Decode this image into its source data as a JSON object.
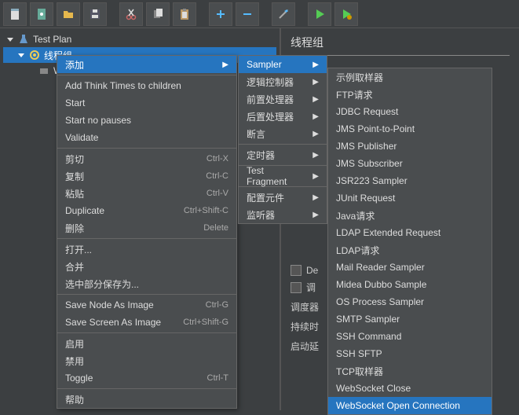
{
  "toolbar_icons": [
    "new",
    "open",
    "folder",
    "save",
    "",
    "cut",
    "copy",
    "paste",
    "",
    "plus",
    "minus",
    "",
    "wand",
    "",
    "run",
    "run-alt"
  ],
  "tree": {
    "root": "Test Plan",
    "thread_group": "线程组",
    "child": "We"
  },
  "right": {
    "title": "线程组",
    "default_cb": "De",
    "debug_cb": "调",
    "scheduler": "调度器",
    "duration": "持续时",
    "startup_delay": "启动延"
  },
  "context": {
    "add": "添加",
    "add_think": "Add Think Times to children",
    "start": "Start",
    "start_no_pauses": "Start no pauses",
    "validate": "Validate",
    "cut": "剪切",
    "copy": "复制",
    "paste": "粘贴",
    "duplicate": "Duplicate",
    "delete": "删除",
    "open": "打开...",
    "merge": "合并",
    "save_sel": "选中部分保存为...",
    "save_node": "Save Node As Image",
    "save_screen": "Save Screen As Image",
    "enable": "启用",
    "disable": "禁用",
    "toggle": "Toggle",
    "help": "帮助",
    "sc_cut": "Ctrl-X",
    "sc_copy": "Ctrl-C",
    "sc_paste": "Ctrl-V",
    "sc_dup": "Ctrl+Shift-C",
    "sc_del": "Delete",
    "sc_g": "Ctrl-G",
    "sc_sg": "Ctrl+Shift-G",
    "sc_t": "Ctrl-T"
  },
  "sub2": {
    "sampler": "Sampler",
    "logic": "逻辑控制器",
    "pre": "前置处理器",
    "post": "后置处理器",
    "assert": "断言",
    "timer": "定时器",
    "frag": "Test Fragment",
    "config": "配置元件",
    "listener": "监听器"
  },
  "sub3": [
    "示例取样器",
    "FTP请求",
    "JDBC Request",
    "JMS Point-to-Point",
    "JMS Publisher",
    "JMS Subscriber",
    "JSR223 Sampler",
    "JUnit Request",
    "Java请求",
    "LDAP Extended Request",
    "LDAP请求",
    "Mail Reader Sampler",
    "Midea Dubbo Sample",
    "OS Process Sampler",
    "SMTP Sampler",
    "SSH Command",
    "SSH SFTP",
    "TCP取样器",
    "WebSocket Close",
    "WebSocket Open Connection"
  ]
}
